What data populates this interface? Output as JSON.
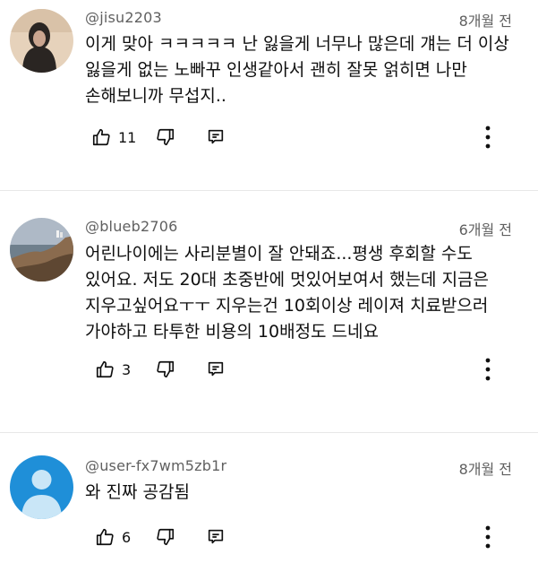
{
  "comments": [
    {
      "handle": "@jisu2203",
      "time": "8개월 전",
      "text": "이게 맞아 ㅋㅋㅋㅋㅋ 난 잃을게 너무나 많은데 걔는 더 이상 잃을게 없는 노빠꾸 인생같아서 괜히 잘못 얽히면 나만 손해보니까 무섭지..",
      "likes": "11",
      "avatar_colors": {
        "bg": "#e6d2bb",
        "figure": "#2a2522"
      }
    },
    {
      "handle": "@blueb2706",
      "time": "6개월 전",
      "text": "어린나이에는 사리분별이 잘 안돼죠...평생 후회할 수도 있어요. 저도 20대 초중반에 멋있어보여서 했는데 지금은 지우고싶어요ㅜㅜ 지우는건 10회이상 레이져 치료받으러 가야하고 타투한 비용의 10배정도 드네요",
      "likes": "3",
      "avatar_colors": {
        "sky": "#aeb9c6",
        "sea": "#6f7f8c",
        "cliff": "#8a6b4e"
      }
    },
    {
      "handle": "@user-fx7wm5zb1r",
      "time": "8개월 전",
      "text": "와 진짜 공감됨",
      "likes": "6",
      "avatar_colors": {
        "bg": "#1f8fd8",
        "figure": "#c9e6f7"
      }
    }
  ],
  "icons": {
    "like": "thumbs-up-icon",
    "dislike": "thumbs-down-icon",
    "reply": "reply-icon",
    "more": "more-vert-icon"
  }
}
